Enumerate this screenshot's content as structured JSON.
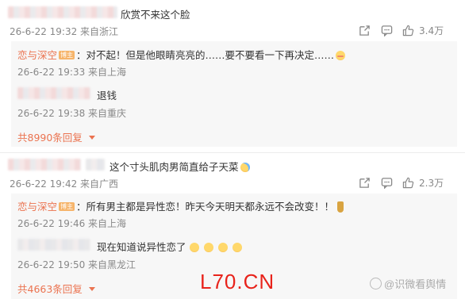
{
  "comment1": {
    "text": "欣赏不来这个脸",
    "meta": "26-6-22 19:32 来自浙江",
    "likes": "3.4万",
    "replies": [
      {
        "name": "恋与深空",
        "badge": "博主",
        "text": "：对不起！但是他眼睛亮亮的……要不要看一下再决定……",
        "meta": "26-6-22 19:33 来自上海"
      },
      {
        "name": "",
        "text": "退钱",
        "meta": "26-6-22 19:38 来自重庆"
      }
    ],
    "more": "共8990条回复"
  },
  "comment2": {
    "text": "这个寸头肌肉男简直给子天菜",
    "meta": "26-6-22 19:42 来自广西",
    "likes": "2.3万",
    "replies": [
      {
        "name": "恋与深空",
        "badge": "博主",
        "text": "：所有男主都是异性恋！昨天今天明天都永远不会改变！！",
        "meta": "26-6-22 19:46 来自上海"
      },
      {
        "name": "",
        "text": "现在知道说异性恋了",
        "meta": "26-6-22 19:50 来自黑龙江"
      }
    ],
    "more": "共4663条回复"
  },
  "watermark": {
    "site": "L70.CN",
    "account": "@识微看舆情"
  },
  "icons": [
    "share-icon",
    "comment-icon",
    "like-icon"
  ],
  "colors": {
    "accent": "#eb7350",
    "meta": "#888888",
    "reply_bg": "#f7f7f7",
    "badge": "#f6b46a"
  }
}
